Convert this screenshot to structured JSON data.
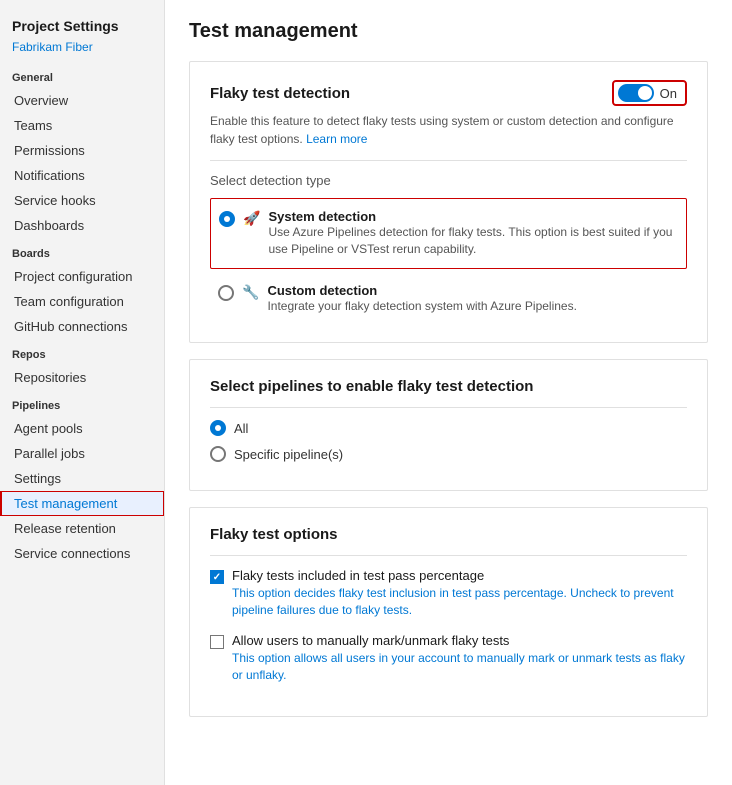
{
  "sidebar": {
    "title": "Project Settings",
    "subtitle": "Fabrikam Fiber",
    "sections": [
      {
        "header": "General",
        "items": [
          {
            "label": "Overview",
            "name": "overview"
          },
          {
            "label": "Teams",
            "name": "teams"
          },
          {
            "label": "Permissions",
            "name": "permissions"
          },
          {
            "label": "Notifications",
            "name": "notifications"
          },
          {
            "label": "Service hooks",
            "name": "service-hooks"
          },
          {
            "label": "Dashboards",
            "name": "dashboards"
          }
        ]
      },
      {
        "header": "Boards",
        "items": [
          {
            "label": "Project configuration",
            "name": "project-configuration"
          },
          {
            "label": "Team configuration",
            "name": "team-configuration"
          },
          {
            "label": "GitHub connections",
            "name": "github-connections"
          }
        ]
      },
      {
        "header": "Repos",
        "items": [
          {
            "label": "Repositories",
            "name": "repositories"
          }
        ]
      },
      {
        "header": "Pipelines",
        "items": [
          {
            "label": "Agent pools",
            "name": "agent-pools"
          },
          {
            "label": "Parallel jobs",
            "name": "parallel-jobs"
          },
          {
            "label": "Settings",
            "name": "settings"
          },
          {
            "label": "Test management",
            "name": "test-management",
            "active": true
          },
          {
            "label": "Release retention",
            "name": "release-retention"
          },
          {
            "label": "Service connections",
            "name": "service-connections"
          }
        ]
      }
    ]
  },
  "main": {
    "page_title": "Test management",
    "flaky_detection": {
      "title": "Flaky test detection",
      "toggle_state": "On",
      "description": "Enable this feature to detect flaky tests using system or custom detection and configure flaky test options.",
      "learn_more": "Learn more"
    },
    "detection_type": {
      "label": "Select detection type",
      "options": [
        {
          "name": "system-detection",
          "title": "System detection",
          "description": "Use Azure Pipelines detection for flaky tests. This option is best suited if you use Pipeline or VSTest rerun capability.",
          "selected": true
        },
        {
          "name": "custom-detection",
          "title": "Custom detection",
          "description": "Integrate your flaky detection system with Azure Pipelines.",
          "selected": false
        }
      ]
    },
    "pipelines": {
      "label": "Select pipelines to enable flaky test detection",
      "options": [
        {
          "label": "All",
          "selected": true
        },
        {
          "label": "Specific pipeline(s)",
          "selected": false
        }
      ]
    },
    "flaky_options": {
      "title": "Flaky test options",
      "checkboxes": [
        {
          "name": "include-in-pass-percentage",
          "title": "Flaky tests included in test pass percentage",
          "description": "This option decides flaky test inclusion in test pass percentage. Uncheck to prevent pipeline failures due to flaky tests.",
          "checked": true
        },
        {
          "name": "allow-manual-mark",
          "title": "Allow users to manually mark/unmark flaky tests",
          "description": "This option allows all users in your account to manually mark or unmark tests as flaky or unflaky.",
          "checked": false
        }
      ]
    }
  },
  "icons": {
    "rocket": "🚀",
    "wrench": "🔧"
  }
}
